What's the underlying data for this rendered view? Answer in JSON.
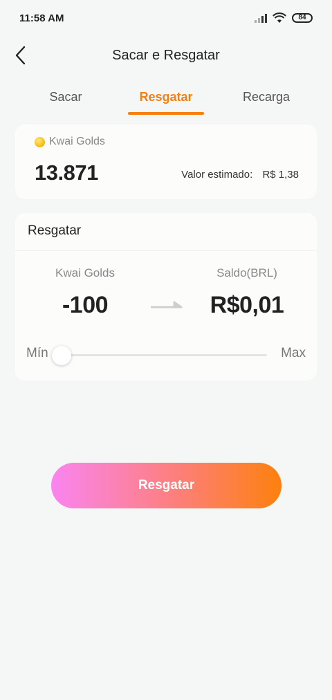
{
  "status_bar": {
    "time": "11:58 AM",
    "battery": "84",
    "icons": [
      "signal-icon",
      "wifi-icon",
      "battery-icon"
    ]
  },
  "header": {
    "title": "Sacar e Resgatar",
    "back_icon": "chevron-left-icon"
  },
  "tabs": [
    {
      "label": "Sacar",
      "active": false
    },
    {
      "label": "Resgatar",
      "active": true
    },
    {
      "label": "Recarga",
      "active": false
    }
  ],
  "balance": {
    "coin_label": "Kwai Golds",
    "value": "13.871",
    "estimate_label": "Valor estimado:",
    "estimate_value": "R$ 1,38"
  },
  "redeem": {
    "title": "Resgatar",
    "from_label": "Kwai Golds",
    "from_amount": "-100",
    "to_label": "Saldo(BRL)",
    "to_amount": "R$0,01",
    "slider_min": "Mín",
    "slider_max": "Max",
    "slider_position": 0
  },
  "action_button": {
    "label": "Resgatar"
  },
  "colors": {
    "accent": "#f5800d",
    "button_gradient_start": "#f985f0",
    "button_gradient_end": "#fd800d",
    "background": "#f5f6f6"
  }
}
